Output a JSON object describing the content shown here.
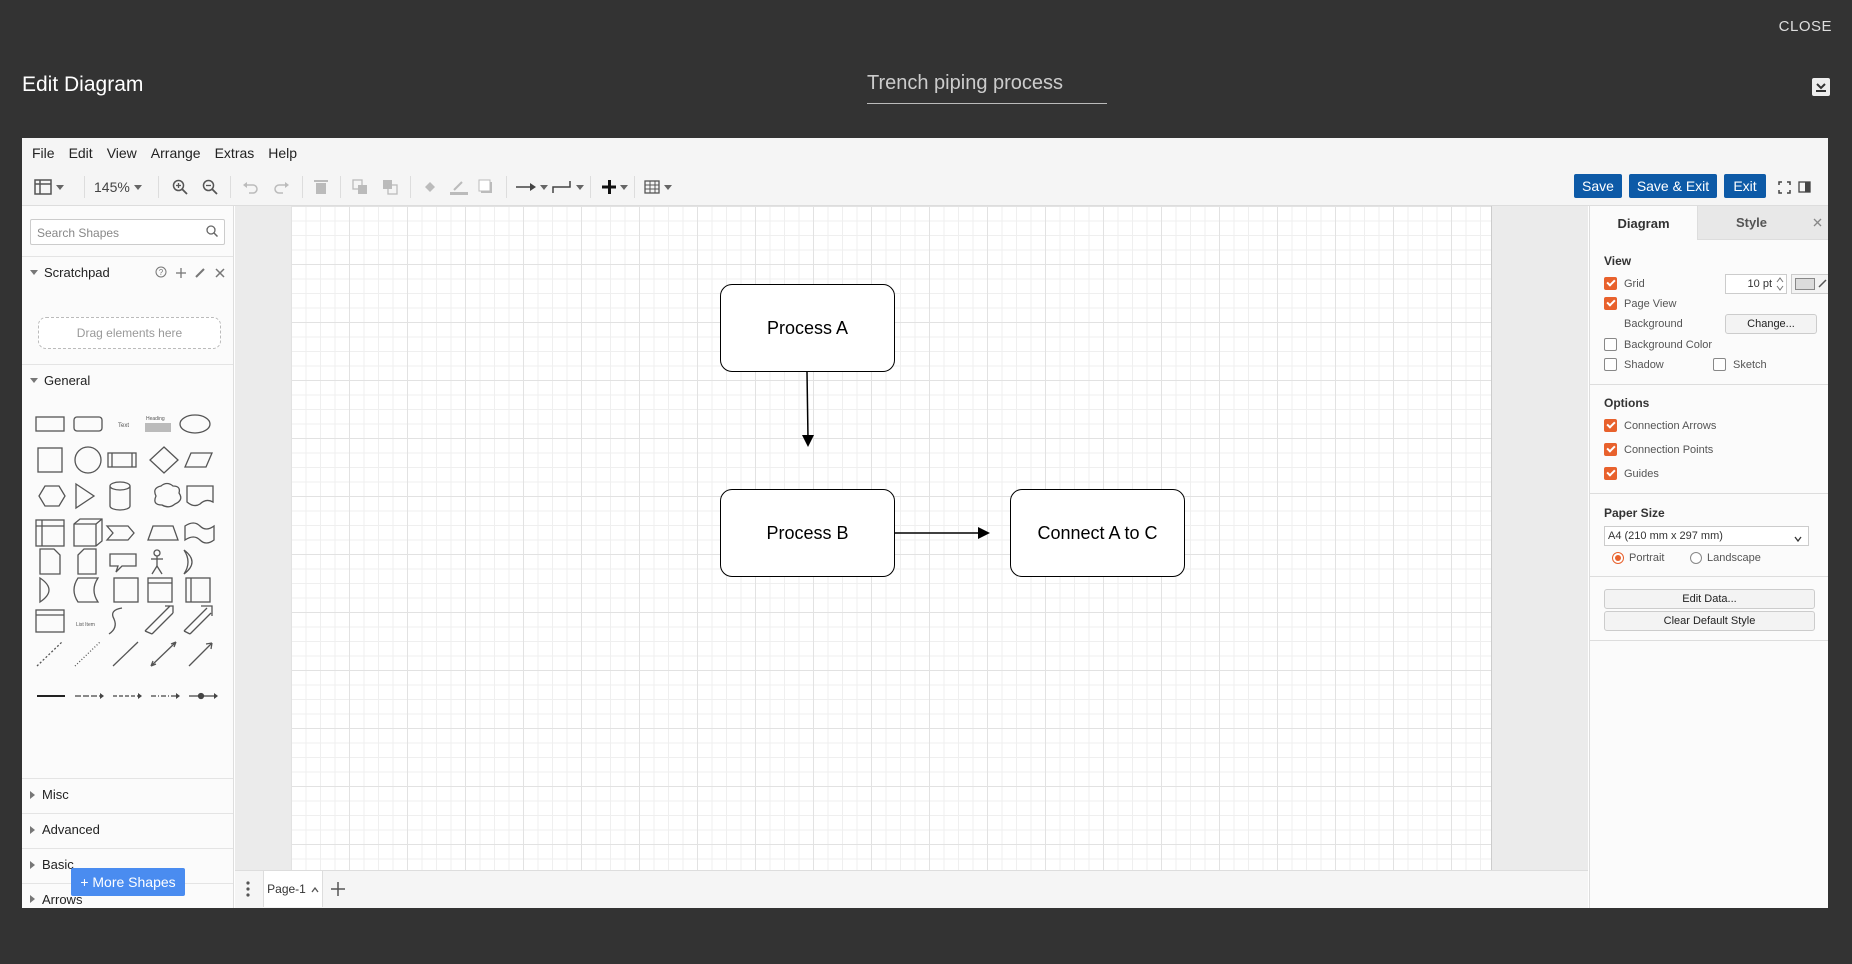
{
  "modal": {
    "close_label": "CLOSE",
    "title": "Edit Diagram",
    "diagram_name": "Trench piping process"
  },
  "menubar": [
    "File",
    "Edit",
    "View",
    "Arrange",
    "Extras",
    "Help"
  ],
  "toolbar": {
    "zoom": "145%",
    "save_label": "Save",
    "save_exit_label": "Save & Exit",
    "exit_label": "Exit"
  },
  "sidebar": {
    "search_placeholder": "Search Shapes",
    "scratchpad_label": "Scratchpad",
    "drag_hint": "Drag elements here",
    "general_label": "General",
    "collapsed_sections": [
      "Misc",
      "Advanced",
      "Basic",
      "Arrows"
    ],
    "more_shapes_label": "+ More Shapes"
  },
  "diagram": {
    "nodes": [
      "Process A",
      "Process B",
      "Connect A to C"
    ]
  },
  "pages": {
    "current": "Page-1"
  },
  "format_panel": {
    "tabs": [
      "Diagram",
      "Style"
    ],
    "view_title": "View",
    "grid_label": "Grid",
    "grid_size": "10 pt",
    "page_view_label": "Page View",
    "background_label": "Background",
    "change_label": "Change...",
    "background_color_label": "Background Color",
    "shadow_label": "Shadow",
    "sketch_label": "Sketch",
    "options_title": "Options",
    "connection_arrows_label": "Connection Arrows",
    "connection_points_label": "Connection Points",
    "guides_label": "Guides",
    "paper_size_title": "Paper Size",
    "paper_size_value": "A4 (210 mm x 297 mm)",
    "portrait_label": "Portrait",
    "landscape_label": "Landscape",
    "edit_data_label": "Edit Data...",
    "clear_default_style_label": "Clear Default Style",
    "checks": {
      "grid": true,
      "page_view": true,
      "background_color": false,
      "shadow": false,
      "sketch": false,
      "connection_arrows": true,
      "connection_points": true,
      "guides": true
    },
    "orientation": "Portrait"
  }
}
